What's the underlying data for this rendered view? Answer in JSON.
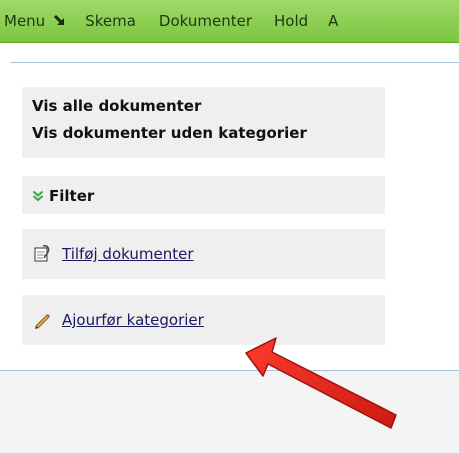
{
  "menu": {
    "items": [
      {
        "label": "Menu"
      },
      {
        "label": "Skema"
      },
      {
        "label": "Dokumenter"
      },
      {
        "label": "Hold"
      },
      {
        "label": "A"
      }
    ]
  },
  "documents": {
    "show_all": "Vis alle dokumenter",
    "show_uncategorized": "Vis dokumenter uden kategorier"
  },
  "filter": {
    "label": "Filter",
    "icon": "double-chevron-down-icon",
    "icon_color": "#3aa84a"
  },
  "actions": {
    "add_documents": {
      "label": "Tilføj dokumenter",
      "icon": "add-document-icon"
    },
    "update_categories": {
      "label": "Ajourfør kategorier",
      "icon": "pencil-icon"
    }
  },
  "annotation": {
    "icon": "red-arrow-icon",
    "color": "#e8231a"
  },
  "colors": {
    "menu_bar": "#86cc45",
    "panel": "#efefef",
    "link": "#1a1a5e"
  }
}
